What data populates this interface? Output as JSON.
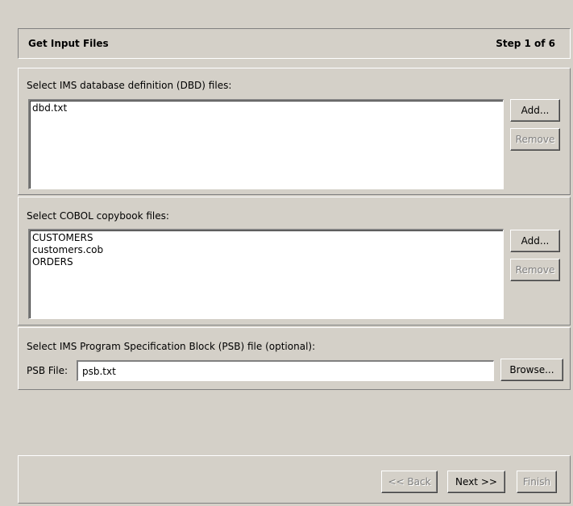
{
  "header": {
    "title": "Get Input Files",
    "step": "Step 1 of 6"
  },
  "dbd_section": {
    "label": "Select IMS database definition (DBD) files:",
    "files": [
      "dbd.txt"
    ],
    "add_label": "Add...",
    "remove_label": "Remove"
  },
  "cobol_section": {
    "label": "Select COBOL copybook files:",
    "files": [
      "CUSTOMERS",
      "customers.cob",
      "ORDERS"
    ],
    "add_label": "Add...",
    "remove_label": "Remove"
  },
  "psb_section": {
    "label": "Select IMS Program Specification Block (PSB) file (optional):",
    "field_label": "PSB File:",
    "field_value": "psb.txt",
    "browse_label": "Browse..."
  },
  "footer": {
    "back_label": "<< Back",
    "next_label": "Next >>",
    "finish_label": "Finish"
  }
}
